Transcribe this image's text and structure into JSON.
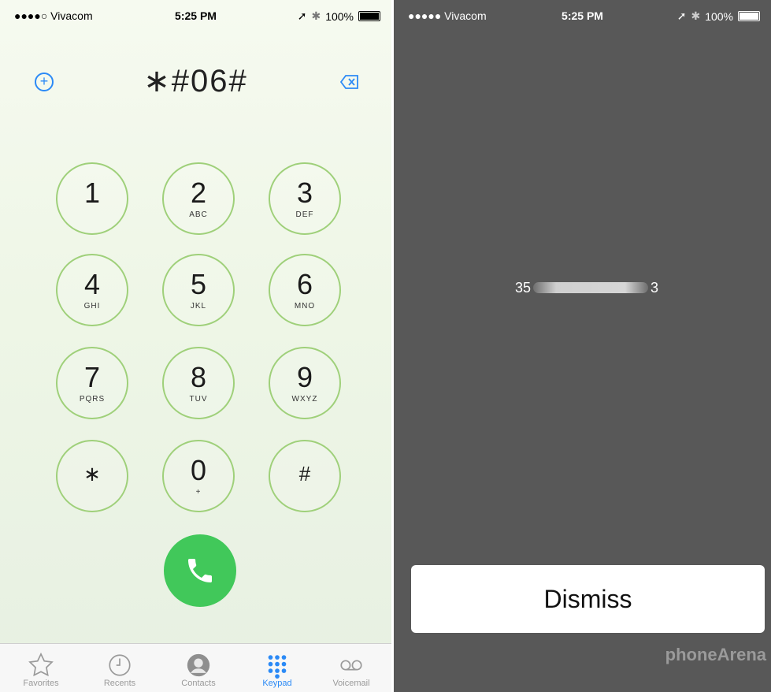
{
  "left_screen": {
    "status": {
      "carrier": "●●●●○ Vivacom",
      "time": "5:25 PM",
      "battery": "100%"
    },
    "dial_display": "∗#06#",
    "keys": [
      {
        "digit": "1",
        "letters": ""
      },
      {
        "digit": "2",
        "letters": "ABC"
      },
      {
        "digit": "3",
        "letters": "DEF"
      },
      {
        "digit": "4",
        "letters": "GHI"
      },
      {
        "digit": "5",
        "letters": "JKL"
      },
      {
        "digit": "6",
        "letters": "MNO"
      },
      {
        "digit": "7",
        "letters": "PQRS"
      },
      {
        "digit": "8",
        "letters": "TUV"
      },
      {
        "digit": "9",
        "letters": "WXYZ"
      },
      {
        "digit": "∗",
        "letters": ""
      },
      {
        "digit": "0",
        "letters": "+"
      },
      {
        "digit": "#",
        "letters": ""
      }
    ],
    "tabs": [
      {
        "label": "Favorites",
        "icon": "star-icon"
      },
      {
        "label": "Recents",
        "icon": "clock-icon"
      },
      {
        "label": "Contacts",
        "icon": "contact-icon"
      },
      {
        "label": "Keypad",
        "icon": "keypad-icon",
        "active": true
      },
      {
        "label": "Voicemail",
        "icon": "voicemail-icon"
      }
    ],
    "colors": {
      "accent": "#2b8af6",
      "key_outline": "#9fd07a",
      "call": "#41c85a"
    }
  },
  "right_screen": {
    "status": {
      "carrier": "●●●●● Vivacom",
      "time": "5:25 PM",
      "battery": "100%"
    },
    "imei_prefix": "35",
    "imei_suffix": "3",
    "dismiss_label": "Dismiss",
    "watermark": "phoneArena"
  }
}
